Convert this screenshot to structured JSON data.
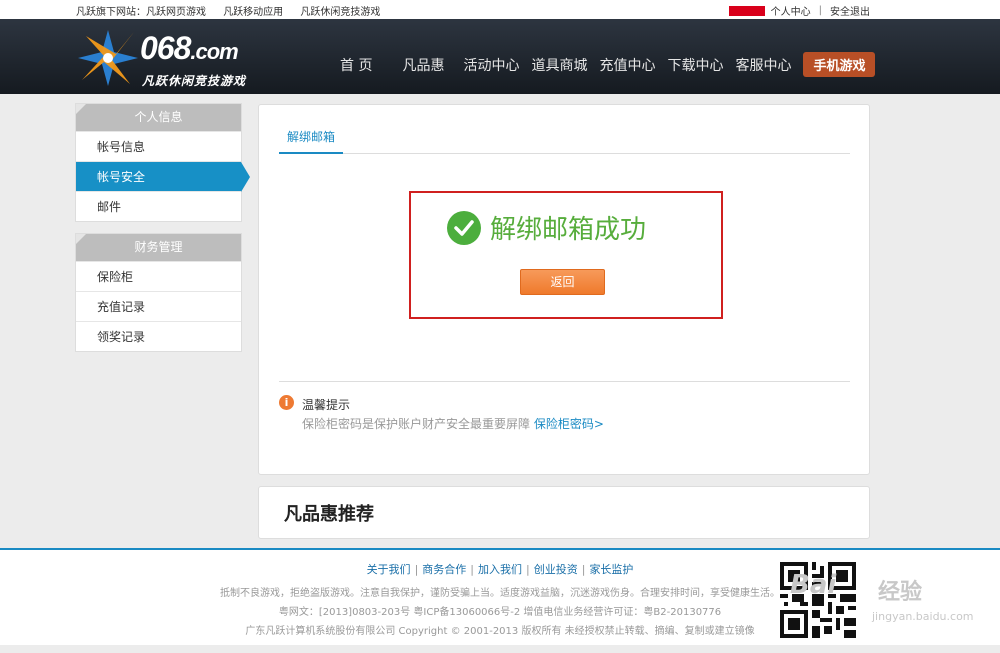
{
  "topbar": {
    "site_prefix": "凡跃旗下网站：",
    "links": [
      "凡跃网页游戏",
      "凡跃移动应用",
      "凡跃休闲竞技游戏"
    ],
    "user_center": "个人中心",
    "separator": "|",
    "logout": "安全退出"
  },
  "header": {
    "brand": "068",
    "brand_suffix": ".com",
    "slogan": "凡跃休闲竞技游戏",
    "nav": [
      "首 页",
      "凡品惠",
      "活动中心",
      "道具商城",
      "充值中心",
      "下载中心",
      "客服中心"
    ],
    "mobile_games": "手机游戏"
  },
  "sidebar": {
    "personal": {
      "title": "个人信息",
      "items": [
        {
          "label": "帐号信息"
        },
        {
          "label": "帐号安全"
        },
        {
          "label": "邮件"
        }
      ]
    },
    "finance": {
      "title": "财务管理",
      "items": [
        {
          "label": "保险柜"
        },
        {
          "label": "充值记录"
        },
        {
          "label": "领奖记录"
        }
      ]
    }
  },
  "main": {
    "tab": "解绑邮箱",
    "success_message": "解绑邮箱成功",
    "back_button": "返回",
    "tip_title": "温馨提示",
    "tip_text": "保险柜密码是保护账户财产安全最重要屏障",
    "tip_link": "保险柜密码>"
  },
  "recommend": {
    "title": "凡品惠推荐"
  },
  "footer": {
    "links": [
      "关于我们",
      "商务合作",
      "加入我们",
      "创业投资",
      "家长监护"
    ],
    "link_sep": "|",
    "health_notice": "抵制不良游戏，拒绝盗版游戏。注意自我保护，谨防受骗上当。适度游戏益脑，沉迷游戏伤身。合理安排时间，享受健康生活。",
    "license": "粤网文：[2013]0803-203号  粤ICP备13060066号-2  增值电信业务经营许可证：粤B2-20130776",
    "copyright": "广东凡跃计算机系统股份有限公司 Copyright © 2001-2013 版权所有 未经授权禁止转载、摘编、复制或建立镜像"
  },
  "watermark": {
    "logo": "Bai",
    "text": "经验",
    "url": "jingyan.baidu.com"
  },
  "colors": {
    "accent_blue": "#1790c6",
    "success_green": "#57ad3c",
    "button_orange": "#ef7a2c",
    "highlight_red": "#d0201f"
  }
}
